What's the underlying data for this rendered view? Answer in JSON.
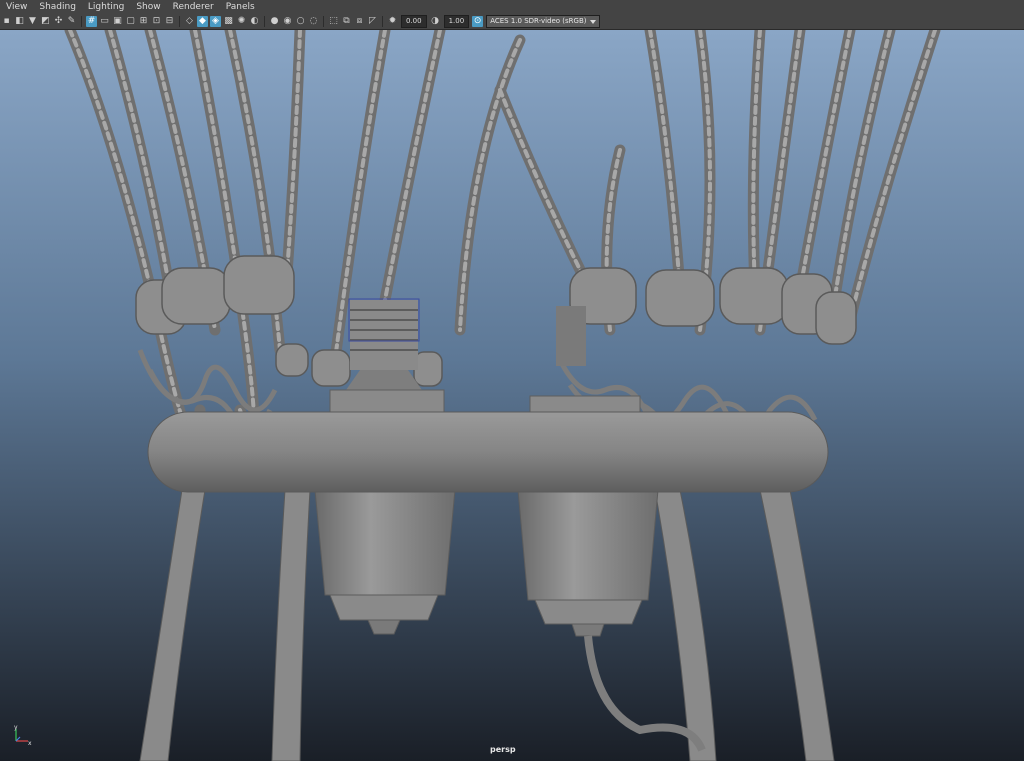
{
  "menus": [
    "View",
    "Shading",
    "Lighting",
    "Show",
    "Renderer",
    "Panels"
  ],
  "toolbar": {
    "exposure_value": "0.00",
    "gamma_value": "1.00",
    "color_management": "ACES 1.0 SDR-video (sRGB)"
  },
  "viewport": {
    "camera_label": "persp",
    "axis_y": "y",
    "axis_x": "x"
  },
  "colors": {
    "background_top": "#8aa6c6",
    "background_bottom": "#1a1f27",
    "model": "#8a8a8a",
    "accent": "#4a9bc4"
  }
}
